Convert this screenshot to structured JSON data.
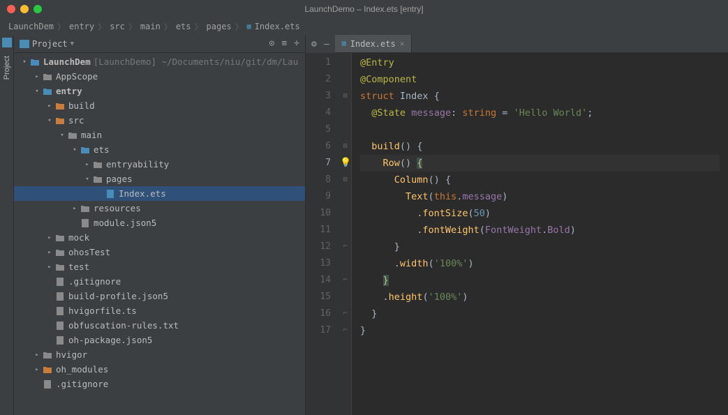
{
  "window": {
    "title": "LaunchDemo – Index.ets [entry]"
  },
  "breadcrumbs": [
    "LaunchDem",
    "entry",
    "src",
    "main",
    "ets",
    "pages",
    "Index.ets"
  ],
  "project": {
    "selector": "Project",
    "tree": [
      {
        "depth": 0,
        "arrow": "down",
        "icon": "folder-blue",
        "label": "LaunchDem",
        "bold": true,
        "suffix": "[LaunchDemo]",
        "suffix2": " ~/Documents/niu/git/dm/Lau"
      },
      {
        "depth": 1,
        "arrow": "right",
        "icon": "folder-grey",
        "label": "AppScope"
      },
      {
        "depth": 1,
        "arrow": "down",
        "icon": "folder-blue",
        "label": "entry",
        "bold": true
      },
      {
        "depth": 2,
        "arrow": "right",
        "icon": "folder-orange",
        "label": "build"
      },
      {
        "depth": 2,
        "arrow": "down",
        "icon": "folder-orange",
        "label": "src"
      },
      {
        "depth": 3,
        "arrow": "down",
        "icon": "folder-grey",
        "label": "main"
      },
      {
        "depth": 4,
        "arrow": "down",
        "icon": "folder-blue",
        "label": "ets"
      },
      {
        "depth": 5,
        "arrow": "right",
        "icon": "folder-grey",
        "label": "entryability"
      },
      {
        "depth": 5,
        "arrow": "down",
        "icon": "folder-grey",
        "label": "pages"
      },
      {
        "depth": 6,
        "arrow": "",
        "icon": "file-blue",
        "label": "Index.ets",
        "selected": true
      },
      {
        "depth": 4,
        "arrow": "right",
        "icon": "folder-grey",
        "label": "resources"
      },
      {
        "depth": 4,
        "arrow": "",
        "icon": "file-grey",
        "label": "module.json5"
      },
      {
        "depth": 2,
        "arrow": "right",
        "icon": "folder-grey",
        "label": "mock"
      },
      {
        "depth": 2,
        "arrow": "right",
        "icon": "folder-grey",
        "label": "ohosTest"
      },
      {
        "depth": 2,
        "arrow": "right",
        "icon": "folder-grey",
        "label": "test"
      },
      {
        "depth": 2,
        "arrow": "",
        "icon": "file-grey",
        "label": ".gitignore"
      },
      {
        "depth": 2,
        "arrow": "",
        "icon": "file-grey",
        "label": "build-profile.json5"
      },
      {
        "depth": 2,
        "arrow": "",
        "icon": "file-grey",
        "label": "hvigorfile.ts"
      },
      {
        "depth": 2,
        "arrow": "",
        "icon": "file-grey",
        "label": "obfuscation-rules.txt"
      },
      {
        "depth": 2,
        "arrow": "",
        "icon": "file-grey",
        "label": "oh-package.json5"
      },
      {
        "depth": 1,
        "arrow": "right",
        "icon": "folder-grey",
        "label": "hvigor"
      },
      {
        "depth": 1,
        "arrow": "right",
        "icon": "folder-orange",
        "label": "oh_modules"
      },
      {
        "depth": 1,
        "arrow": "",
        "icon": "file-grey",
        "label": ".gitignore"
      }
    ]
  },
  "sideTabs": {
    "project": "Project"
  },
  "editor": {
    "tab": {
      "name": "Index.ets"
    },
    "currentLine": 7,
    "code": [
      {
        "n": 1,
        "tokens": [
          [
            "ann",
            "@Entry"
          ]
        ]
      },
      {
        "n": 2,
        "tokens": [
          [
            "ann",
            "@Component"
          ]
        ]
      },
      {
        "n": 3,
        "fold": "-",
        "tokens": [
          [
            "kw",
            "struct"
          ],
          [
            "plain",
            " "
          ],
          [
            "type",
            "Index"
          ],
          [
            "plain",
            " "
          ],
          [
            "brace",
            "{"
          ]
        ]
      },
      {
        "n": 4,
        "tokens": [
          [
            "plain",
            "  "
          ],
          [
            "ann",
            "@State"
          ],
          [
            "plain",
            " "
          ],
          [
            "prop",
            "message"
          ],
          [
            "punct",
            ":"
          ],
          [
            "plain",
            " "
          ],
          [
            "typeref",
            "string"
          ],
          [
            "plain",
            " "
          ],
          [
            "punct",
            "="
          ],
          [
            "plain",
            " "
          ],
          [
            "str",
            "'Hello World'"
          ],
          [
            "punct",
            ";"
          ]
        ]
      },
      {
        "n": 5,
        "tokens": []
      },
      {
        "n": 6,
        "fold": "-",
        "tokens": [
          [
            "plain",
            "  "
          ],
          [
            "func",
            "build"
          ],
          [
            "punct",
            "()"
          ],
          [
            "plain",
            " "
          ],
          [
            "brace",
            "{"
          ]
        ]
      },
      {
        "n": 7,
        "fold": "-",
        "bulb": true,
        "tokens": [
          [
            "plain",
            "    "
          ],
          [
            "func",
            "Row"
          ],
          [
            "punct",
            "()"
          ],
          [
            "plain",
            " "
          ],
          [
            "brace-y",
            "{"
          ]
        ]
      },
      {
        "n": 8,
        "fold": "-",
        "tokens": [
          [
            "plain",
            "      "
          ],
          [
            "func",
            "Column"
          ],
          [
            "punct",
            "()"
          ],
          [
            "plain",
            " "
          ],
          [
            "brace",
            "{"
          ]
        ]
      },
      {
        "n": 9,
        "tokens": [
          [
            "plain",
            "        "
          ],
          [
            "func",
            "Text"
          ],
          [
            "punct",
            "("
          ],
          [
            "this",
            "this"
          ],
          [
            "punct",
            "."
          ],
          [
            "prop",
            "message"
          ],
          [
            "punct",
            ")"
          ]
        ]
      },
      {
        "n": 10,
        "tokens": [
          [
            "plain",
            "          "
          ],
          [
            "punct",
            "."
          ],
          [
            "func",
            "fontSize"
          ],
          [
            "punct",
            "("
          ],
          [
            "num",
            "50"
          ],
          [
            "punct",
            ")"
          ]
        ]
      },
      {
        "n": 11,
        "tokens": [
          [
            "plain",
            "          "
          ],
          [
            "punct",
            "."
          ],
          [
            "func",
            "fontWeight"
          ],
          [
            "punct",
            "("
          ],
          [
            "obj",
            "FontWeight"
          ],
          [
            "punct",
            "."
          ],
          [
            "prop",
            "Bold"
          ],
          [
            "punct",
            ")"
          ]
        ]
      },
      {
        "n": 12,
        "fold": "e",
        "tokens": [
          [
            "plain",
            "      "
          ],
          [
            "brace",
            "}"
          ]
        ]
      },
      {
        "n": 13,
        "tokens": [
          [
            "plain",
            "      "
          ],
          [
            "punct",
            "."
          ],
          [
            "func",
            "width"
          ],
          [
            "punct",
            "("
          ],
          [
            "str",
            "'100%'"
          ],
          [
            "punct",
            ")"
          ]
        ]
      },
      {
        "n": 14,
        "fold": "e",
        "tokens": [
          [
            "plain",
            "    "
          ],
          [
            "brace-y",
            "}"
          ]
        ]
      },
      {
        "n": 15,
        "tokens": [
          [
            "plain",
            "    "
          ],
          [
            "punct",
            "."
          ],
          [
            "func",
            "height"
          ],
          [
            "punct",
            "("
          ],
          [
            "str",
            "'100%'"
          ],
          [
            "punct",
            ")"
          ]
        ]
      },
      {
        "n": 16,
        "fold": "e",
        "tokens": [
          [
            "plain",
            "  "
          ],
          [
            "brace",
            "}"
          ]
        ]
      },
      {
        "n": 17,
        "fold": "e",
        "tokens": [
          [
            "brace",
            "}"
          ]
        ]
      }
    ]
  }
}
